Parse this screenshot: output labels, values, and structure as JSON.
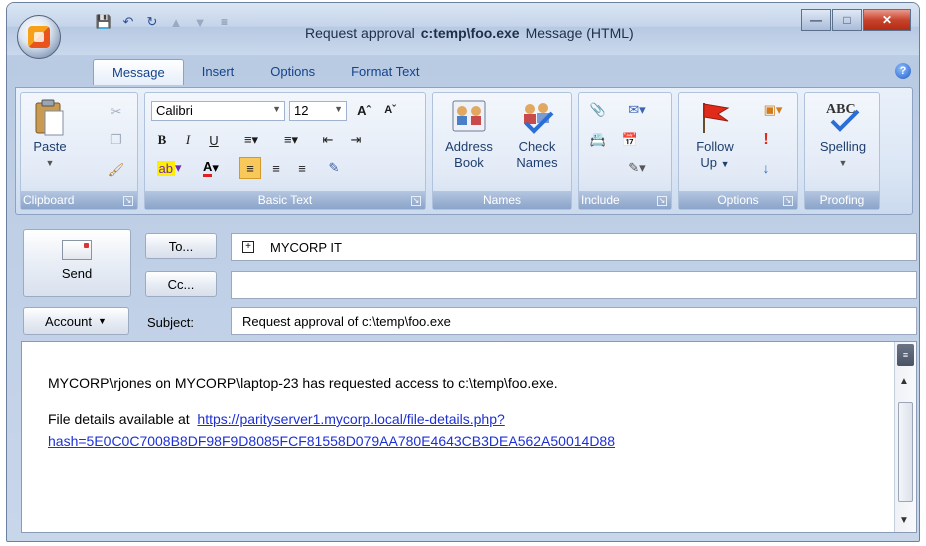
{
  "titlebar": {
    "title_prefix": "Request approval",
    "title_bold": "c:temp\\foo.exe",
    "title_suffix": "Message (HTML)"
  },
  "tabs": [
    "Message",
    "Insert",
    "Options",
    "Format Text"
  ],
  "ribbon": {
    "clipboard": {
      "label": "Clipboard",
      "paste": "Paste"
    },
    "basic_text": {
      "label": "Basic Text",
      "font": "Calibri",
      "size": "12"
    },
    "names": {
      "label": "Names",
      "address_book_1": "Address",
      "address_book_2": "Book",
      "check_names_1": "Check",
      "check_names_2": "Names"
    },
    "include": {
      "label": "Include"
    },
    "options": {
      "label": "Options",
      "follow_up_1": "Follow",
      "follow_up_2": "Up"
    },
    "proofing": {
      "label": "Proofing",
      "spelling": "Spelling"
    }
  },
  "header": {
    "send": "Send",
    "to_button": "To...",
    "cc_button": "Cc...",
    "to_value": "MYCORP IT",
    "cc_value": "",
    "account_button": "Account",
    "subject_label": "Subject:",
    "subject_value": "Request approval of c:\\temp\\foo.exe"
  },
  "body": {
    "line1": "MYCORP\\rjones on MYCORP\\laptop-23 has requested access to c:\\temp\\foo.exe.",
    "details_label": "File details available at",
    "link_part1": "https://parityserver1.mycorp.local/file-details.php?",
    "link_part2": "hash=5E0C0C7008B8DF98F9D8085FCF81558D079AA780E4643CB3DEA562A50014D88"
  }
}
